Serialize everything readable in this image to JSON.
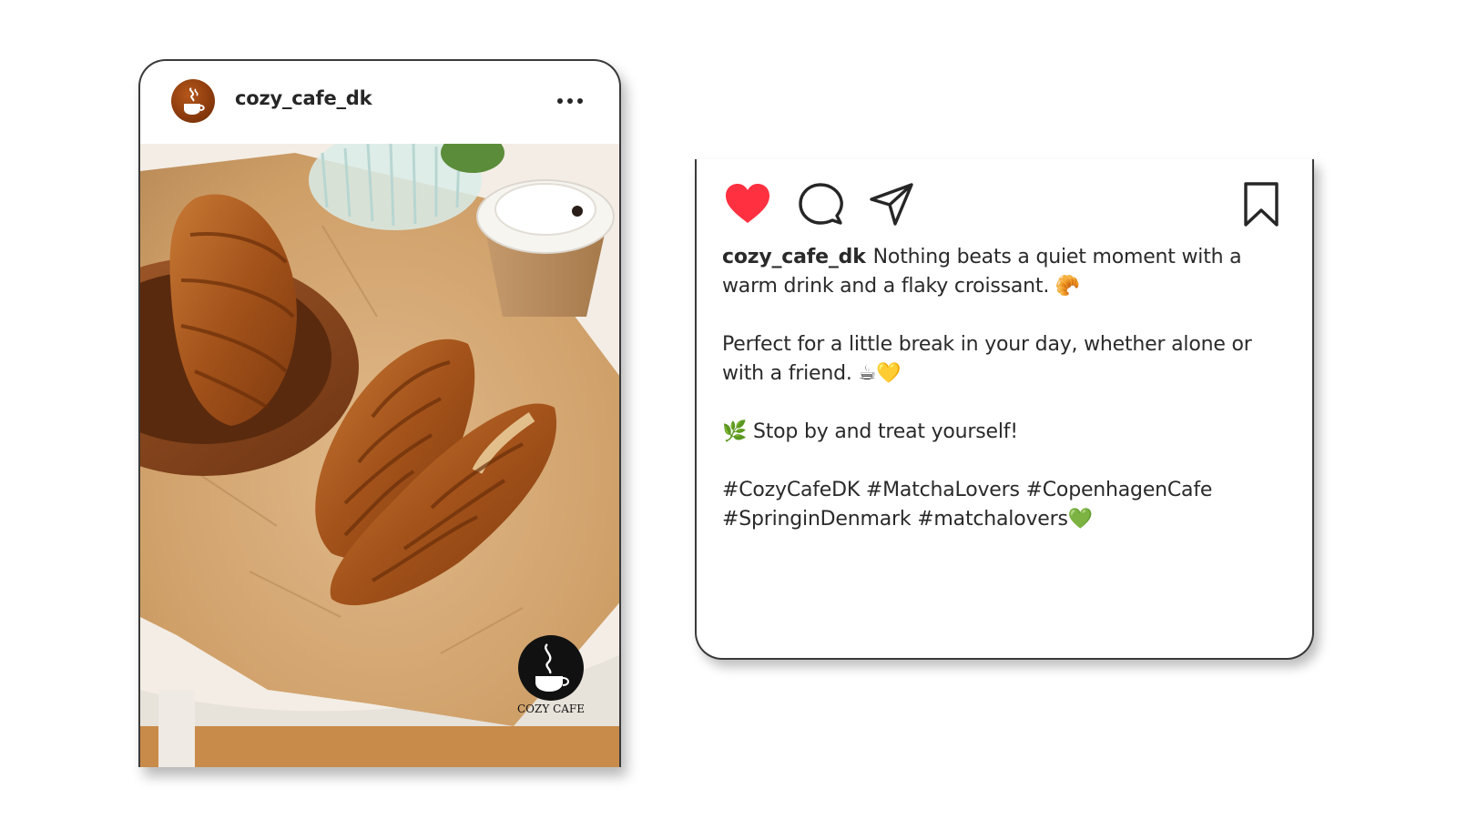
{
  "post": {
    "username": "cozy_cafe_dk",
    "more_icon": "more-horizontal-icon",
    "photo_watermark": "COZY CAFE"
  },
  "actions": {
    "like_icon": "heart-filled-icon",
    "like_color": "#ff3040",
    "comment_icon": "comment-icon",
    "share_icon": "send-icon",
    "save_icon": "bookmark-icon"
  },
  "caption": {
    "username": "cozy_cafe_dk",
    "line1": "Nothing beats a quiet moment with a warm drink and a flaky croissant. 🥐",
    "line2": "Perfect for a little break in your day, whether alone or with a friend. ☕💛",
    "line3": "🌿 Stop by and treat yourself!",
    "hashtags": "#CozyCafeDK #MatchaLovers #CopenhagenCafe #SpringinDenmark #matchalovers💚"
  }
}
